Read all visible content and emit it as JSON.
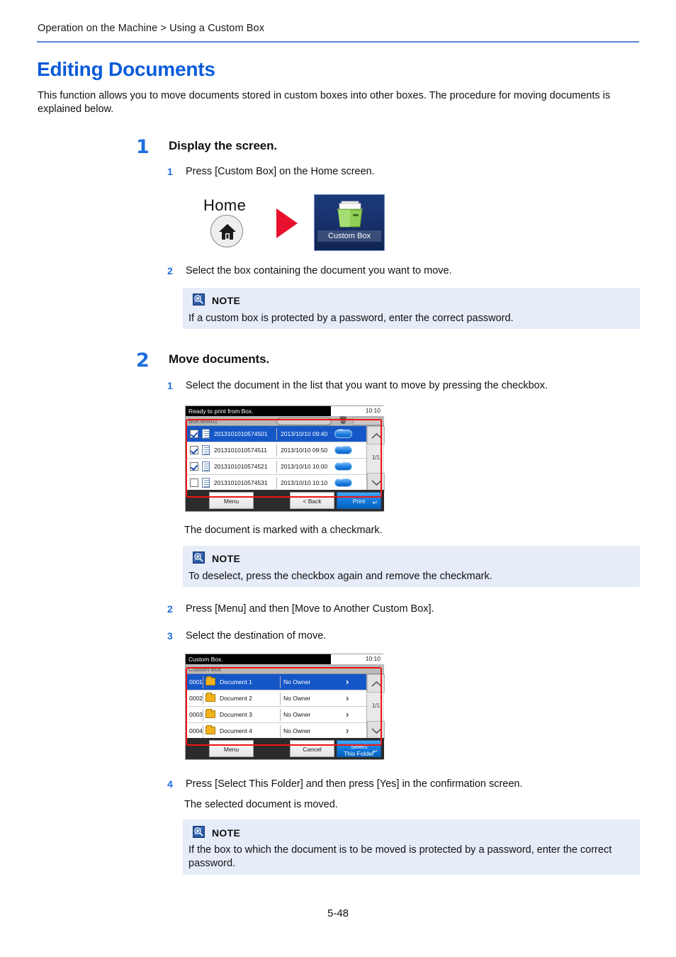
{
  "breadcrumb": "Operation on the Machine > Using a Custom Box",
  "title": "Editing Documents",
  "intro": "This function allows you to move documents stored in custom boxes into other boxes. The procedure for moving documents is explained below.",
  "page_number": "5-48",
  "colors": {
    "accent_blue": "#0a5bdc",
    "rule_blue": "#5b87d6",
    "note_bg": "#e6ecf8",
    "highlight_red": "#f01414",
    "selected_row": "#1657c8"
  },
  "step1": {
    "number": "1",
    "title": "Display the screen.",
    "sub1_number": "1",
    "sub1_text": "Press [Custom Box] on the Home screen.",
    "sub2_number": "2",
    "sub2_text": "Select the box containing the document you want to move.",
    "home_label": "Home",
    "custom_box_tile_label": "Custom Box",
    "note": {
      "heading": "NOTE",
      "body": "If a custom box is protected by a password, enter the correct password."
    }
  },
  "step2": {
    "number": "2",
    "title": "Move documents.",
    "sub1_number": "1",
    "sub1_text": "Select the document in the list that you want to move by pressing the checkbox.",
    "caption1": "The document is marked with a checkmark.",
    "note1": {
      "heading": "NOTE",
      "body": "To deselect, press the checkbox again and remove the checkmark."
    },
    "sub2_number": "2",
    "sub2_text": "Press [Menu] and then [Move to Another Custom Box].",
    "sub3_number": "3",
    "sub3_text": "Select the destination of move.",
    "sub4_number": "4",
    "sub4_text": "Press [Select This Folder] and then press [Yes] in the confirmation screen.",
    "caption2": "The selected document is moved.",
    "note2": {
      "heading": "NOTE",
      "body": "If the box to which the document is to be moved is protected by a password, enter the correct password."
    }
  },
  "panel_documents": {
    "status_message": "Ready to print from Box.",
    "clock": "10:10",
    "box_label": "Box:Box01",
    "page_indicator": "1/1",
    "rows": [
      {
        "checked": true,
        "name": "2013101010574501",
        "date": "2013/10/10 09:40"
      },
      {
        "checked": true,
        "name": "2013101010574511",
        "date": "2013/10/10 09:50"
      },
      {
        "checked": true,
        "name": "2013101010574521",
        "date": "2013/10/10 10:00"
      },
      {
        "checked": false,
        "name": "2013101010574531",
        "date": "2013/10/10 10:10"
      }
    ],
    "buttons": {
      "menu": "Menu",
      "back": "< Back",
      "print": "Print"
    }
  },
  "panel_folders": {
    "status_message": "Custom Box.",
    "clock": "10:10",
    "box_label": "Custom Box",
    "page_indicator": "1/1",
    "rows": [
      {
        "index": "0001",
        "name": "Document 1",
        "owner": "No Owner"
      },
      {
        "index": "0002",
        "name": "Document 2",
        "owner": "No Owner"
      },
      {
        "index": "0003",
        "name": "Document 3",
        "owner": "No Owner"
      },
      {
        "index": "0004",
        "name": "Document 4",
        "owner": "No Owner"
      }
    ],
    "buttons": {
      "menu": "Menu",
      "cancel": "Cancel",
      "select_line1": "Select",
      "select_line2": "This Folder"
    }
  }
}
